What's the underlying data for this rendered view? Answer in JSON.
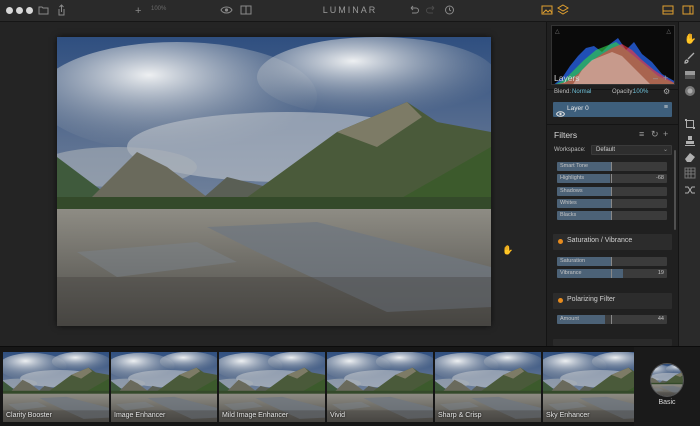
{
  "app": {
    "title": "LUMINAR",
    "zoom": "100%"
  },
  "layers": {
    "title": "Layers",
    "blend_label": "Blend:",
    "blend_value": "Normal",
    "opacity_label": "Opacity:",
    "opacity_value": "100%",
    "items": [
      {
        "name": "Layer 0"
      }
    ]
  },
  "filters": {
    "title": "Filters",
    "workspace_label": "Workspace:",
    "workspace_value": "Default",
    "tone_sliders": [
      {
        "label": "Smart Tone",
        "value": "",
        "level": 0.5
      },
      {
        "label": "Highlights",
        "value": "-68",
        "level": 0.48
      },
      {
        "label": "Shadows",
        "value": "",
        "level": 0.5
      },
      {
        "label": "Whites",
        "value": "",
        "level": 0.5
      },
      {
        "label": "Blacks",
        "value": "",
        "level": 0.5
      }
    ],
    "saturation_vibrance": {
      "name": "Saturation / Vibrance",
      "sliders": [
        {
          "label": "Saturation",
          "value": "",
          "level": 0.5
        },
        {
          "label": "Vibrance",
          "value": "19",
          "level": 0.6
        }
      ]
    },
    "polarizing": {
      "name": "Polarizing Filter",
      "sliders": [
        {
          "label": "Amount",
          "value": "44",
          "level": 0.44
        }
      ]
    }
  },
  "presets": [
    {
      "label": "Clarity Booster"
    },
    {
      "label": "Image Enhancer"
    },
    {
      "label": "Mild Image Enhancer"
    },
    {
      "label": "Vivid"
    },
    {
      "label": "Sharp & Crisp"
    },
    {
      "label": "Sky Enhancer"
    }
  ],
  "preset_category": {
    "label": "Basic"
  },
  "icons": {
    "titlebar": [
      "folder-icon",
      "share-icon",
      "add-icon",
      "eye-icon",
      "compare-icon",
      "undo-icon",
      "redo-icon",
      "history-icon",
      "image-panel-icon",
      "layers-panel-icon",
      "panel-icon",
      "sidebar-icon"
    ],
    "tools": [
      "hand-icon",
      "brush-icon",
      "gradient-icon",
      "radial-icon",
      "crop-icon",
      "stamp-icon",
      "eraser-icon",
      "pattern-icon",
      "transform-icon"
    ]
  },
  "colors": {
    "accent": "#6ec1d9",
    "filter_dot": "#e88c1e",
    "layer_selected": "#3e5f7c"
  }
}
